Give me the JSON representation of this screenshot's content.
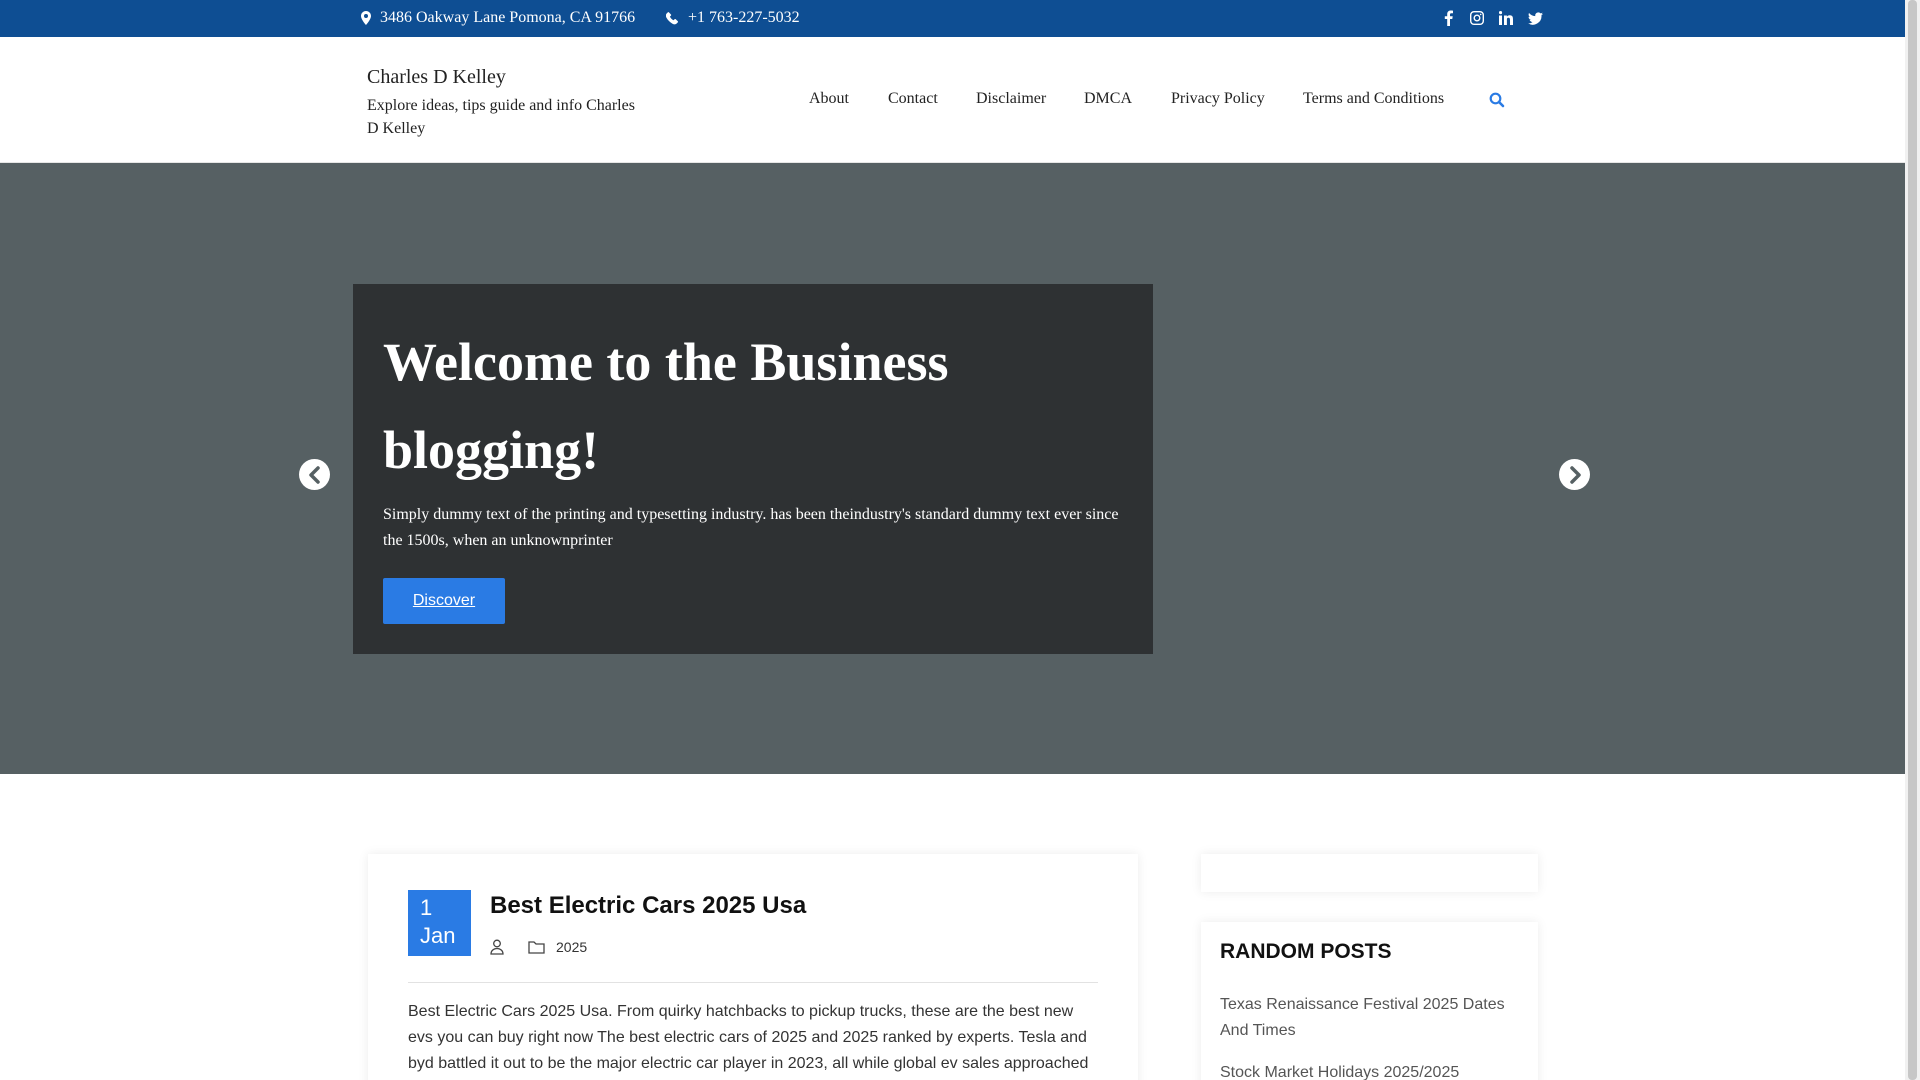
{
  "topbar": {
    "address": "3486 Oakway Lane Pomona, CA 91766",
    "phone": "+1 763-227-5032",
    "social_icons": [
      "facebook-icon",
      "instagram-icon",
      "linkedin-icon",
      "twitter-icon"
    ]
  },
  "header": {
    "site_title": "Charles D Kelley",
    "tagline": "Explore ideas, tips guide and info Charles D Kelley",
    "nav": [
      "About",
      "Contact",
      "Disclaimer",
      "DMCA",
      "Privacy Policy",
      "Terms and Conditions"
    ]
  },
  "hero": {
    "title": "Welcome to the Business blogging!",
    "text": "Simply dummy text of the printing and typesetting industry. has been theindustry's standard dummy text ever since the 1500s, when an unknownprinter",
    "button": "Discover"
  },
  "post": {
    "day": "1",
    "month": "Jan",
    "title": "Best Electric Cars 2025 Usa",
    "category": "2025",
    "excerpt": "Best Electric Cars 2025 Usa. From quirky hatchbacks to pickup trucks, these are the best new evs you can buy right now The best electric cars of 2025 and 2025 ranked by experts. Tesla and byd battled it out to be the major electric car player in 2023, all while global ev sales approached"
  },
  "sidebar": {
    "random_title": "RANDOM POSTS",
    "random_posts": [
      "Texas Renaissance Festival 2025 Dates And Times",
      "Stock Market Holidays 2025/2025"
    ]
  },
  "colors": {
    "topbar": "#0e4e93",
    "accent": "#2a7be4",
    "hero_bg": "#566063",
    "hero_box": "#2e3133"
  }
}
